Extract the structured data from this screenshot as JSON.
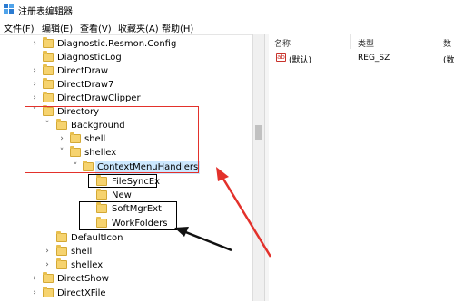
{
  "window": {
    "title": "注册表编辑器"
  },
  "menu": [
    "文件(F)",
    "编辑(E)",
    "查看(V)",
    "收藏夹(A)",
    "帮助(H)"
  ],
  "tree": [
    {
      "label": "Diagnostic.Resmon.Config",
      "expander": ">",
      "selected": false
    },
    {
      "label": "DiagnosticLog",
      "expander": "",
      "selected": false
    },
    {
      "label": "DirectDraw",
      "expander": ">",
      "selected": false
    },
    {
      "label": "DirectDraw7",
      "expander": ">",
      "selected": false
    },
    {
      "label": "DirectDrawClipper",
      "expander": ">",
      "selected": false
    },
    {
      "label": "Directory",
      "expander": "v",
      "selected": false
    },
    {
      "label": "Background",
      "expander": "v",
      "selected": false
    },
    {
      "label": "shell",
      "expander": ">",
      "selected": false
    },
    {
      "label": "shellex",
      "expander": "v",
      "selected": false
    },
    {
      "label": "ContextMenuHandlers",
      "expander": "v",
      "selected": true
    },
    {
      "label": "FileSyncEx",
      "expander": "",
      "selected": false
    },
    {
      "label": "New",
      "expander": "",
      "selected": false
    },
    {
      "label": "SoftMgrExt",
      "expander": "",
      "selected": false
    },
    {
      "label": "WorkFolders",
      "expander": "",
      "selected": false
    },
    {
      "label": "DefaultIcon",
      "expander": "",
      "selected": false
    },
    {
      "label": "shell",
      "expander": ">",
      "selected": false
    },
    {
      "label": "shellex",
      "expander": ">",
      "selected": false
    },
    {
      "label": "DirectShow",
      "expander": ">",
      "selected": false
    },
    {
      "label": "DirectXFile",
      "expander": ">",
      "selected": false
    }
  ],
  "list": {
    "columns": [
      "名称",
      "类型",
      "数"
    ],
    "rows": [
      {
        "icon": "ab",
        "name": "(默认)",
        "type": "REG_SZ",
        "data": "(数"
      }
    ]
  },
  "annotations": {
    "red_box_color": "#e3312b",
    "black_box_color": "#000000"
  }
}
